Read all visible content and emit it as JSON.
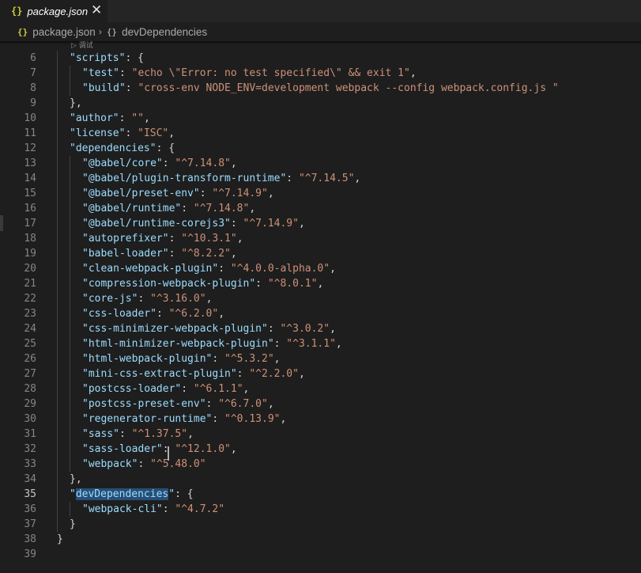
{
  "tab": {
    "icon": "{}",
    "title": "package.json",
    "close": "✕"
  },
  "breadcrumb": {
    "icon": "{}",
    "file": "package.json",
    "sep": "›",
    "icon2": "{}",
    "symbol": "devDependencies"
  },
  "codelens": "▷ 调试",
  "lines": [
    {
      "n": "6",
      "indent": 1,
      "key": "scripts",
      "value": null,
      "tail": ": {"
    },
    {
      "n": "7",
      "indent": 2,
      "key": "test",
      "value": "echo \\\"Error: no test specified\\\" && exit 1",
      "tail": ","
    },
    {
      "n": "8",
      "indent": 2,
      "key": "build",
      "value": "cross-env NODE_ENV=development webpack --config webpack.config.js ",
      "tail": ""
    },
    {
      "n": "9",
      "indent": 1,
      "key": null,
      "value": null,
      "tail": "},"
    },
    {
      "n": "10",
      "indent": 1,
      "key": "author",
      "value": "",
      "tail": ","
    },
    {
      "n": "11",
      "indent": 1,
      "key": "license",
      "value": "ISC",
      "tail": ","
    },
    {
      "n": "12",
      "indent": 1,
      "key": "dependencies",
      "value": null,
      "tail": ": {"
    },
    {
      "n": "13",
      "indent": 2,
      "key": "@babel/core",
      "value": "^7.14.8",
      "tail": ","
    },
    {
      "n": "14",
      "indent": 2,
      "key": "@babel/plugin-transform-runtime",
      "value": "^7.14.5",
      "tail": ","
    },
    {
      "n": "15",
      "indent": 2,
      "key": "@babel/preset-env",
      "value": "^7.14.9",
      "tail": ","
    },
    {
      "n": "16",
      "indent": 2,
      "key": "@babel/runtime",
      "value": "^7.14.8",
      "tail": ","
    },
    {
      "n": "17",
      "indent": 2,
      "key": "@babel/runtime-corejs3",
      "value": "^7.14.9",
      "tail": ","
    },
    {
      "n": "18",
      "indent": 2,
      "key": "autoprefixer",
      "value": "^10.3.1",
      "tail": ","
    },
    {
      "n": "19",
      "indent": 2,
      "key": "babel-loader",
      "value": "^8.2.2",
      "tail": ","
    },
    {
      "n": "20",
      "indent": 2,
      "key": "clean-webpack-plugin",
      "value": "^4.0.0-alpha.0",
      "tail": ","
    },
    {
      "n": "21",
      "indent": 2,
      "key": "compression-webpack-plugin",
      "value": "^8.0.1",
      "tail": ","
    },
    {
      "n": "22",
      "indent": 2,
      "key": "core-js",
      "value": "^3.16.0",
      "tail": ","
    },
    {
      "n": "23",
      "indent": 2,
      "key": "css-loader",
      "value": "^6.2.0",
      "tail": ","
    },
    {
      "n": "24",
      "indent": 2,
      "key": "css-minimizer-webpack-plugin",
      "value": "^3.0.2",
      "tail": ","
    },
    {
      "n": "25",
      "indent": 2,
      "key": "html-minimizer-webpack-plugin",
      "value": "^3.1.1",
      "tail": ","
    },
    {
      "n": "26",
      "indent": 2,
      "key": "html-webpack-plugin",
      "value": "^5.3.2",
      "tail": ","
    },
    {
      "n": "27",
      "indent": 2,
      "key": "mini-css-extract-plugin",
      "value": "^2.2.0",
      "tail": ","
    },
    {
      "n": "28",
      "indent": 2,
      "key": "postcss-loader",
      "value": "^6.1.1",
      "tail": ","
    },
    {
      "n": "29",
      "indent": 2,
      "key": "postcss-preset-env",
      "value": "^6.7.0",
      "tail": ","
    },
    {
      "n": "30",
      "indent": 2,
      "key": "regenerator-runtime",
      "value": "^0.13.9",
      "tail": ","
    },
    {
      "n": "31",
      "indent": 2,
      "key": "sass",
      "value": "^1.37.5",
      "tail": ","
    },
    {
      "n": "32",
      "indent": 2,
      "key": "sass-loader",
      "value": "^12.1.0",
      "tail": ","
    },
    {
      "n": "33",
      "indent": 2,
      "key": "webpack",
      "value": "^5.48.0",
      "tail": ""
    },
    {
      "n": "34",
      "indent": 1,
      "key": null,
      "value": null,
      "tail": "},"
    },
    {
      "n": "35",
      "indent": 1,
      "key": "devDependencies",
      "value": null,
      "tail": ": {",
      "selected": true
    },
    {
      "n": "36",
      "indent": 2,
      "key": "webpack-cli",
      "value": "^4.7.2",
      "tail": ""
    },
    {
      "n": "37",
      "indent": 1,
      "key": null,
      "value": null,
      "tail": "}"
    },
    {
      "n": "38",
      "indent": 0,
      "key": null,
      "value": null,
      "tail": "}"
    },
    {
      "n": "39",
      "indent": 0,
      "key": null,
      "value": null,
      "tail": ""
    }
  ],
  "active_line": "35",
  "colors": {
    "key": "#9cdcfe",
    "string": "#ce9178",
    "punct": "#d4d4d4",
    "json_icon": "#cbcb41",
    "selection": "#264f78"
  }
}
